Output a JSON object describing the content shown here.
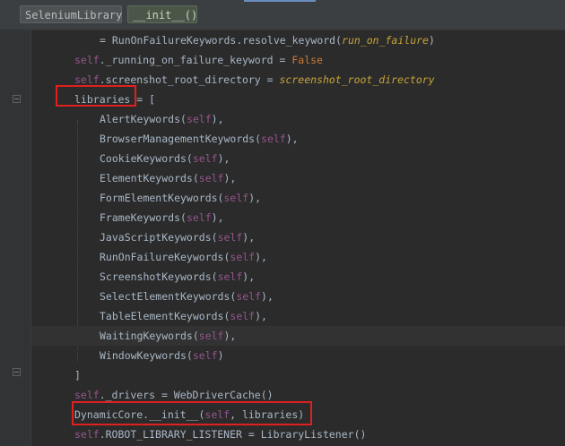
{
  "breadcrumbs": [
    "SeleniumLibrary",
    "__init__()"
  ],
  "code_lines": [
    {
      "tokens": [
        {
          "t": "= RunOnFailureKeywords.resolve_keyword(",
          "c": "plain"
        },
        {
          "t": "run_on_failure",
          "c": "it"
        },
        {
          "t": ")",
          "c": "plain"
        }
      ]
    },
    {
      "tokens": [
        {
          "t": "self",
          "c": "kw-self"
        },
        {
          "t": "._running_on_failure_keyword = ",
          "c": "plain"
        },
        {
          "t": "False",
          "c": "orange"
        }
      ]
    },
    {
      "tokens": [
        {
          "t": "self",
          "c": "kw-self"
        },
        {
          "t": ".screenshot_root_directory = ",
          "c": "plain"
        },
        {
          "t": "screenshot_root_directory",
          "c": "it"
        }
      ]
    },
    {
      "tokens": [
        {
          "t": "libraries = [",
          "c": "plain"
        }
      ]
    },
    {
      "tokens": [
        {
          "t": "AlertKeywords(",
          "c": "plain"
        },
        {
          "t": "self",
          "c": "kw-self"
        },
        {
          "t": "),",
          "c": "plain"
        }
      ]
    },
    {
      "tokens": [
        {
          "t": "BrowserManagementKeywords(",
          "c": "plain"
        },
        {
          "t": "self",
          "c": "kw-self"
        },
        {
          "t": "),",
          "c": "plain"
        }
      ]
    },
    {
      "tokens": [
        {
          "t": "CookieKeywords(",
          "c": "plain"
        },
        {
          "t": "self",
          "c": "kw-self"
        },
        {
          "t": "),",
          "c": "plain"
        }
      ]
    },
    {
      "tokens": [
        {
          "t": "ElementKeywords(",
          "c": "plain"
        },
        {
          "t": "self",
          "c": "kw-self"
        },
        {
          "t": "),",
          "c": "plain"
        }
      ]
    },
    {
      "tokens": [
        {
          "t": "FormElementKeywords(",
          "c": "plain"
        },
        {
          "t": "self",
          "c": "kw-self"
        },
        {
          "t": "),",
          "c": "plain"
        }
      ]
    },
    {
      "tokens": [
        {
          "t": "FrameKeywords(",
          "c": "plain"
        },
        {
          "t": "self",
          "c": "kw-self"
        },
        {
          "t": "),",
          "c": "plain"
        }
      ]
    },
    {
      "tokens": [
        {
          "t": "JavaScriptKeywords(",
          "c": "plain"
        },
        {
          "t": "self",
          "c": "kw-self"
        },
        {
          "t": "),",
          "c": "plain"
        }
      ]
    },
    {
      "tokens": [
        {
          "t": "RunOnFailureKeywords(",
          "c": "plain"
        },
        {
          "t": "self",
          "c": "kw-self"
        },
        {
          "t": "),",
          "c": "plain"
        }
      ]
    },
    {
      "tokens": [
        {
          "t": "ScreenshotKeywords(",
          "c": "plain"
        },
        {
          "t": "self",
          "c": "kw-self"
        },
        {
          "t": "),",
          "c": "plain"
        }
      ]
    },
    {
      "tokens": [
        {
          "t": "SelectElementKeywords(",
          "c": "plain"
        },
        {
          "t": "self",
          "c": "kw-self"
        },
        {
          "t": "),",
          "c": "plain"
        }
      ]
    },
    {
      "tokens": [
        {
          "t": "TableElementKeywords(",
          "c": "plain"
        },
        {
          "t": "self",
          "c": "kw-self"
        },
        {
          "t": "),",
          "c": "plain"
        }
      ]
    },
    {
      "tokens": [
        {
          "t": "WaitingKeywords(",
          "c": "plain"
        },
        {
          "t": "self",
          "c": "kw-self"
        },
        {
          "t": "),",
          "c": "plain"
        }
      ]
    },
    {
      "tokens": [
        {
          "t": "WindowKeywords(",
          "c": "plain"
        },
        {
          "t": "self",
          "c": "kw-self"
        },
        {
          "t": ")",
          "c": "plain"
        }
      ]
    },
    {
      "tokens": [
        {
          "t": "]",
          "c": "plain"
        }
      ]
    },
    {
      "tokens": [
        {
          "t": "self",
          "c": "kw-self"
        },
        {
          "t": "._drivers = WebDriverCache()",
          "c": "plain"
        }
      ]
    },
    {
      "tokens": [
        {
          "t": "DynamicCore.__init__(",
          "c": "plain"
        },
        {
          "t": "self",
          "c": "kw-self"
        },
        {
          "t": ", libraries)",
          "c": "plain"
        }
      ]
    },
    {
      "tokens": [
        {
          "t": "self",
          "c": "kw-self"
        },
        {
          "t": ".ROBOT_LIBRARY_LISTENER = LibraryListener()",
          "c": "plain"
        }
      ]
    }
  ],
  "highlighted_line_index": 15,
  "colors": {
    "background": "#2b2b2b",
    "self_keyword": "#94558d",
    "italic_param": "#c7a43a",
    "constant": "#cc7832",
    "annotation_box": "#e02020"
  },
  "icons": [
    "fold-marker-icon"
  ]
}
